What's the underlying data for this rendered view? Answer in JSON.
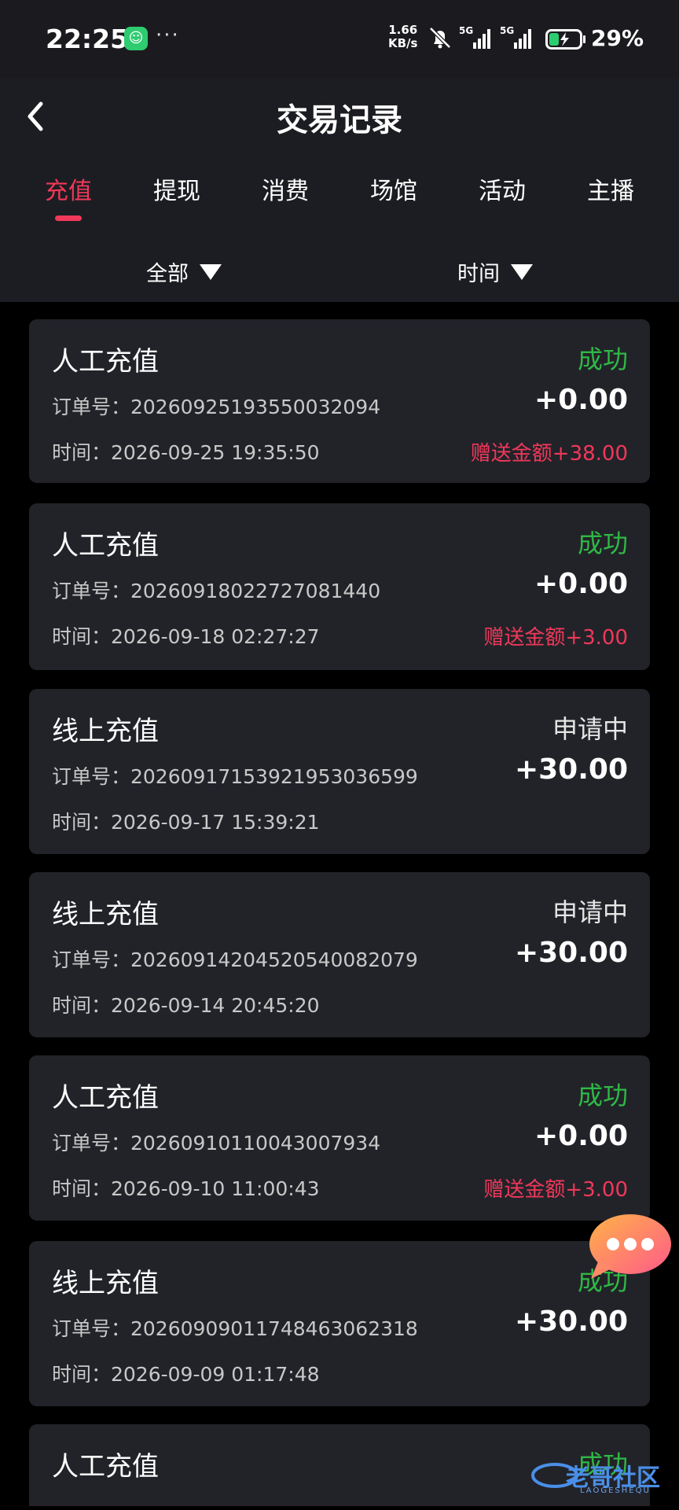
{
  "status_bar": {
    "time": "22:25",
    "dots": "···",
    "speed_value": "1.66",
    "speed_unit": "KB/s",
    "network1": "5G",
    "network2": "5G",
    "battery_percent": "29%"
  },
  "header": {
    "title": "交易记录"
  },
  "tabs": [
    "充值",
    "提现",
    "消费",
    "场馆",
    "活动",
    "主播"
  ],
  "active_tab": "充值",
  "filters": {
    "category": "全部",
    "time": "时间"
  },
  "records": [
    {
      "type": "人工充值",
      "status": "成功",
      "order": "订单号：20260925193550032094",
      "amount": "+0.00",
      "time": "时间：2026-09-25 19:35:50",
      "bonus": "赠送金额+38.00"
    },
    {
      "type": "人工充值",
      "status": "成功",
      "order": "订单号：20260918022727081440",
      "amount": "+0.00",
      "time": "时间：2026-09-18 02:27:27",
      "bonus": "赠送金额+3.00"
    },
    {
      "type": "线上充值",
      "status": "申请中",
      "order": "订单号：202609171539219530365​99",
      "amount": "+30.00",
      "time": "时间：2026-09-17 15:39:21",
      "bonus": ""
    },
    {
      "type": "线上充值",
      "status": "申请中",
      "order": "订单号：202609142045205400820​79",
      "amount": "+30.00",
      "time": "时间：2026-09-14 20:45:20",
      "bonus": ""
    },
    {
      "type": "人工充值",
      "status": "成功",
      "order": "订单号：20260910110043007934",
      "amount": "+0.00",
      "time": "时间：2026-09-10 11:00:43",
      "bonus": "赠送金额+3.00"
    },
    {
      "type": "线上充值",
      "status": "成功",
      "order": "订单号：202609090117484630623​18",
      "amount": "+30.00",
      "time": "时间：2026-09-09 01:17:48",
      "bonus": ""
    },
    {
      "type": "人工充值",
      "status": "成功",
      "order": "",
      "amount": "",
      "time": "",
      "bonus": ""
    }
  ],
  "watermark": {
    "text": "老哥社区",
    "sub": "LAOGESHEQU"
  },
  "colors": {
    "accent": "#f0385a",
    "success": "#2fb845",
    "card_bg": "#222329",
    "header_bg": "#1c1d22"
  }
}
